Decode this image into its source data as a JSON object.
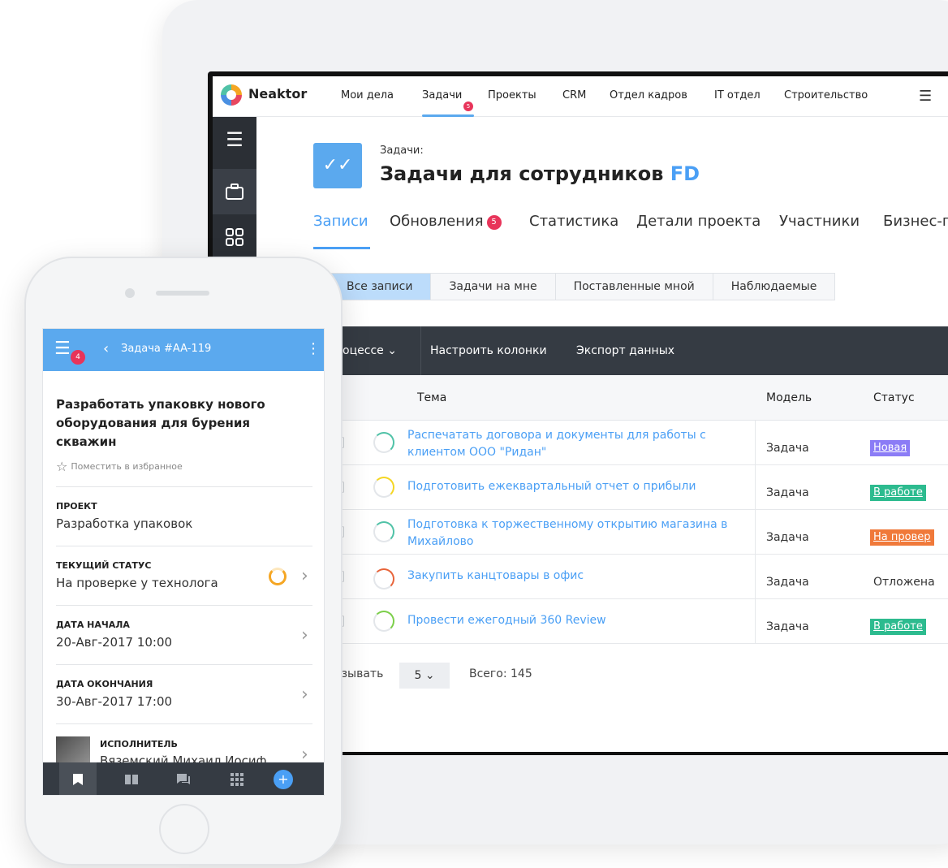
{
  "laptop": {
    "app_name": "Neaktor",
    "nav": [
      "Мои дела",
      "Задачи",
      "Проекты",
      "CRM",
      "Отдел кадров",
      "IT отдел",
      "Строительство"
    ],
    "nav_badge": "5",
    "project_label": "Задачи:",
    "project_title": "Задачи для сотрудников",
    "project_suffix": "FD",
    "tabs": [
      "Записи",
      "Обновления",
      "Статистика",
      "Детали проекта",
      "Участники",
      "Бизнес-п"
    ],
    "updates_badge": "5",
    "filters": [
      "Все записи",
      "Задачи на мне",
      "Поставленные мной",
      "Наблюдаемые"
    ],
    "toolbar": [
      "процессе",
      "Настроить колонки",
      "Экспорт данных"
    ],
    "columns": [
      "Тема",
      "Модель",
      "Статус"
    ],
    "rows": [
      {
        "subject": "Распечатать договора и документы для работы с клиентом ООО \"Ридан\"",
        "model": "Задача",
        "status": "Новая",
        "status_color": "#8b7cf6",
        "ring": "#50c2a7"
      },
      {
        "subject": "Подготовить ежеквартальный отчет о прибыли",
        "model": "Задача",
        "status": "В работе",
        "status_color": "#2dbb8f",
        "ring": "#f5d623"
      },
      {
        "subject": "Подготовка к торжественному открытию магазина в Михайлово",
        "model": "Задача",
        "status": "На провер",
        "status_color": "#f0793a",
        "ring": "#50c2a7"
      },
      {
        "subject": "Закупить канцтовары в офис",
        "model": "Задача",
        "status": "Отложена",
        "status_color": "",
        "ring": "#e8643a"
      },
      {
        "subject": "Провести ежегодный 360 Review",
        "model": "Задача",
        "status": "В работе",
        "status_color": "#2dbb8f",
        "ring": "#7ccf4a"
      }
    ],
    "pager_label": "азывать",
    "pager_value": "5",
    "total": "Всего: 145"
  },
  "phone": {
    "menu_badge": "4",
    "title": "Задача #AA-119",
    "task_title": "Разработать упаковку нового оборудования для бурения скважин",
    "favorite": "Поместить в избранное",
    "fields": [
      {
        "label": "ПРОЕКТ",
        "value": "Разработка упаковок"
      },
      {
        "label": "ТЕКУЩИЙ СТАТУС",
        "value": "На проверке у технолога"
      },
      {
        "label": "ДАТА НАЧАЛА",
        "value": "20-Авг-2017 10:00"
      },
      {
        "label": "ДАТА ОКОНЧАНИЯ",
        "value": "30-Авг-2017 17:00"
      }
    ],
    "executor_label": "ИСПОЛНИТЕЛЬ",
    "executor_value": "Вяземский Михаил Иосиф"
  }
}
